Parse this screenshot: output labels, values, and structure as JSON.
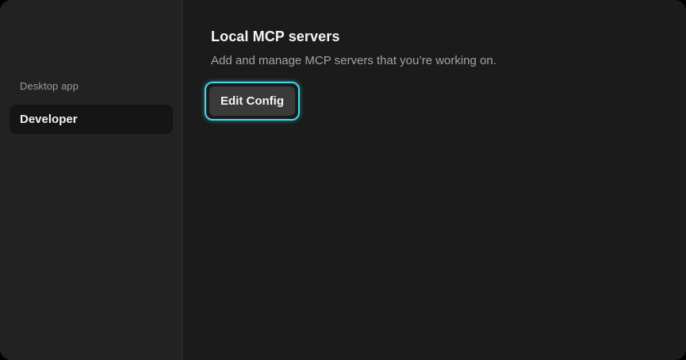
{
  "sidebar": {
    "section_label": "Desktop app",
    "items": [
      {
        "label": "Developer",
        "selected": true
      }
    ]
  },
  "main": {
    "title": "Local MCP servers",
    "subtitle": "Add and manage MCP servers that you’re working on.",
    "edit_config_label": "Edit Config"
  },
  "colors": {
    "focus_ring": "#3fd9ea",
    "background": "#1b1b1b",
    "sidebar_background": "#222222"
  }
}
